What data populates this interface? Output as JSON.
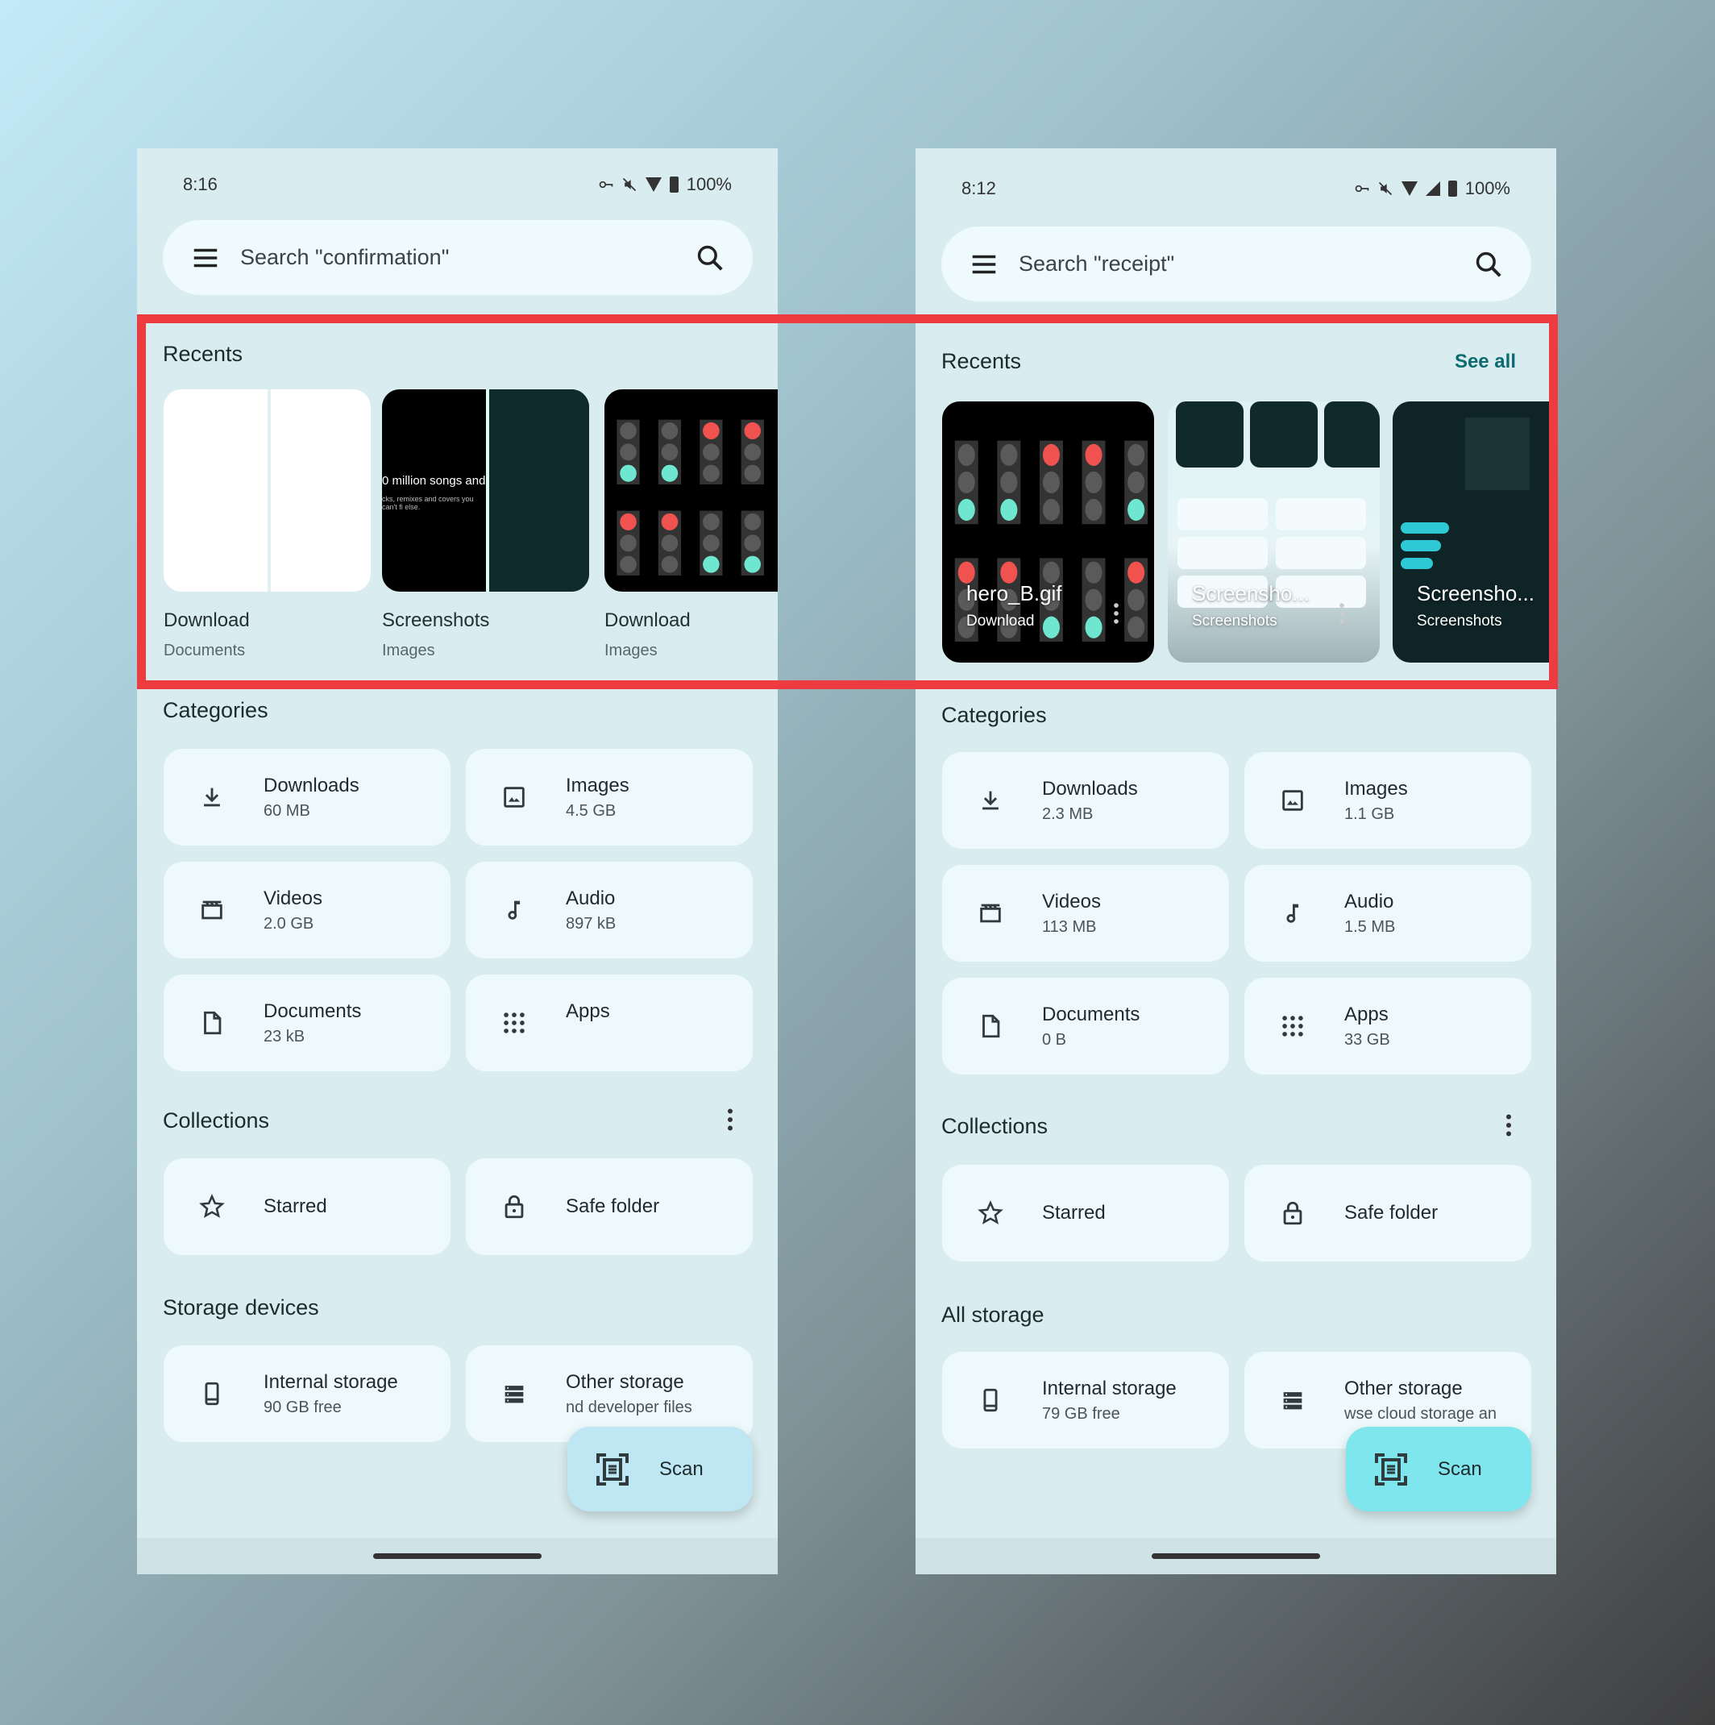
{
  "highlight_color": "#ee3b3f",
  "phones": [
    {
      "status": {
        "time": "8:16",
        "battery": "100%",
        "icons": [
          "vpn-key-icon",
          "mute-icon",
          "wifi-icon",
          "battery-icon"
        ]
      },
      "search": {
        "placeholder": "Search \"confirmation\""
      },
      "recents": {
        "title": "Recents",
        "see_all": null,
        "style": "labels-below",
        "items": [
          {
            "title": "Download",
            "subtitle": "Documents",
            "thumb": "white-document"
          },
          {
            "title": "Screenshots",
            "subtitle": "Images",
            "thumb": "screenshot-dark",
            "snippet": "0 million songs and c",
            "snippet_sub": "cks, remixes and covers you can't fi else."
          },
          {
            "title": "Download",
            "subtitle": "Images",
            "thumb": "traffic-lights"
          }
        ]
      },
      "categories": {
        "title": "Categories",
        "items": [
          {
            "label": "Downloads",
            "size": "60 MB",
            "icon": "download-icon"
          },
          {
            "label": "Images",
            "size": "4.5 GB",
            "icon": "image-icon"
          },
          {
            "label": "Videos",
            "size": "2.0 GB",
            "icon": "video-icon"
          },
          {
            "label": "Audio",
            "size": "897 kB",
            "icon": "music-note-icon"
          },
          {
            "label": "Documents",
            "size": "23 kB",
            "icon": "document-icon"
          },
          {
            "label": "Apps",
            "size": "",
            "icon": "apps-grid-icon"
          }
        ]
      },
      "collections": {
        "title": "Collections",
        "items": [
          {
            "label": "Starred",
            "icon": "star-icon"
          },
          {
            "label": "Safe folder",
            "icon": "lock-icon"
          }
        ]
      },
      "storage": {
        "title": "Storage devices",
        "items": [
          {
            "label": "Internal storage",
            "sub": "90 GB free",
            "icon": "phone-icon"
          },
          {
            "label": "Other storage",
            "sub": "nd developer files",
            "icon": "storage-list-icon"
          }
        ]
      },
      "scan": {
        "label": "Scan",
        "color": "#bfe6f3"
      }
    },
    {
      "status": {
        "time": "8:12",
        "battery": "100%",
        "icons": [
          "vpn-key-icon",
          "mute-icon",
          "wifi-icon",
          "signal-icon",
          "battery-icon"
        ]
      },
      "search": {
        "placeholder": "Search \"receipt\""
      },
      "recents": {
        "title": "Recents",
        "see_all": "See all",
        "style": "labels-overlay",
        "items": [
          {
            "title": "hero_B.gif",
            "subtitle": "Download",
            "thumb": "traffic-lights"
          },
          {
            "title": "Screensho...",
            "subtitle": "Screenshots",
            "thumb": "screenshot-light"
          },
          {
            "title": "Screensho...",
            "subtitle": "Screenshots",
            "thumb": "screenshot-teal"
          }
        ]
      },
      "categories": {
        "title": "Categories",
        "items": [
          {
            "label": "Downloads",
            "size": "2.3 MB",
            "icon": "download-icon"
          },
          {
            "label": "Images",
            "size": "1.1 GB",
            "icon": "image-icon"
          },
          {
            "label": "Videos",
            "size": "113 MB",
            "icon": "video-icon"
          },
          {
            "label": "Audio",
            "size": "1.5 MB",
            "icon": "music-note-icon"
          },
          {
            "label": "Documents",
            "size": "0 B",
            "icon": "document-icon"
          },
          {
            "label": "Apps",
            "size": "33 GB",
            "icon": "apps-grid-icon"
          }
        ]
      },
      "collections": {
        "title": "Collections",
        "items": [
          {
            "label": "Starred",
            "icon": "star-icon"
          },
          {
            "label": "Safe folder",
            "icon": "lock-icon"
          }
        ]
      },
      "storage": {
        "title": "All storage",
        "items": [
          {
            "label": "Internal storage",
            "sub": "79 GB free",
            "icon": "phone-icon"
          },
          {
            "label": "Other storage",
            "sub": "wse cloud storage an",
            "icon": "storage-list-icon"
          }
        ]
      },
      "scan": {
        "label": "Scan",
        "color": "#7fe6ee"
      }
    }
  ]
}
